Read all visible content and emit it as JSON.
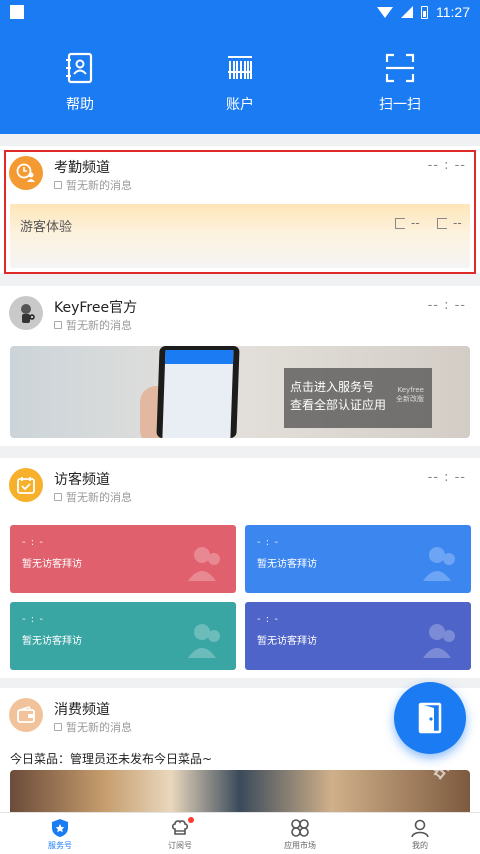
{
  "status_bar": {
    "time": "11:27"
  },
  "quick_actions": [
    {
      "label": "帮助",
      "icon": "address-book-icon"
    },
    {
      "label": "账户",
      "icon": "barcode-icon"
    },
    {
      "label": "扫一扫",
      "icon": "scan-icon"
    }
  ],
  "attendance": {
    "title": "考勤频道",
    "subtitle": "暂无新的消息",
    "time": "-- : --",
    "guest_label": "游客体验",
    "checkin_value": "--",
    "checkout_value": "--"
  },
  "keyfree": {
    "title": "KeyFree官方",
    "subtitle": "暂无新的消息",
    "time": "-- : --",
    "banner_line1": "点击进入服务号",
    "banner_line2": "查看全部认证应用",
    "banner_brand": "Keyfree",
    "banner_brand_sub": "全新改版"
  },
  "visitor": {
    "title": "访客频道",
    "subtitle": "暂无新的消息",
    "time": "-- : --",
    "tiles": [
      {
        "time": "- : -",
        "text": "暂无访客拜访",
        "color": "#e0606e"
      },
      {
        "time": "- : -",
        "text": "暂无访客拜访",
        "color": "#3c86f0"
      },
      {
        "time": "- : -",
        "text": "暂无访客拜访",
        "color": "#3aa6a4"
      },
      {
        "time": "- : -",
        "text": "暂无访客拜访",
        "color": "#4f64c8"
      }
    ]
  },
  "consumption": {
    "title": "消费频道",
    "subtitle": "暂无新的消息",
    "menu_text": "今日菜品：管理员还未发布今日菜品~"
  },
  "watermark": "无限软件站",
  "bottom_nav": [
    {
      "label": "服务号",
      "active": true
    },
    {
      "label": "订阅号",
      "active": false
    },
    {
      "label": "应用市场",
      "active": false
    },
    {
      "label": "我的",
      "active": false
    }
  ],
  "colors": {
    "brand": "#1a7bf2",
    "highlight": "#e02a2a"
  }
}
